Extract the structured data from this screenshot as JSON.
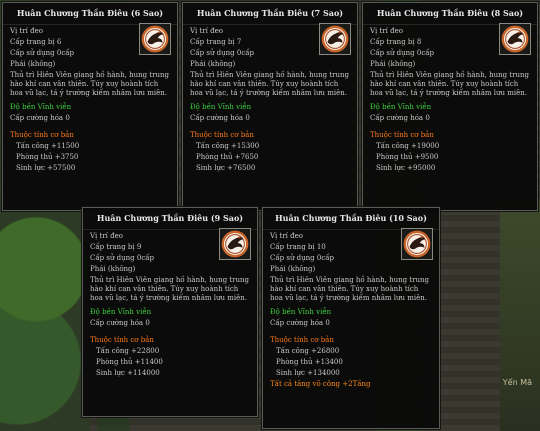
{
  "background": {
    "corner_text": "Yến Mã",
    "corner_text2": ""
  },
  "cards": [
    {
      "title": "Huân Chương Thần Điêu (6 Sao)",
      "position_label": "Vị trí đeo",
      "equip_level": "Cấp trang bị  6",
      "use_level": "Cấp sử dụng   0cấp",
      "faction": "Phái  (không)",
      "description": "Thủ trì Hiên Viên giang hồ hành, hung trung hào khí can vân thiên. Túy xuy hoành tích hoa vũ lạc, tá ý trường kiếm nhâm lưu miên.",
      "durability": "Độ bền   Vĩnh viễn",
      "enhance": "Cấp cường hóa   0",
      "base_header": "Thuộc tính cơ bản",
      "stats": [
        "Tấn công  +11500",
        "Phòng thủ  +3750",
        "Sinh lực  +57500"
      ],
      "bonus": ""
    },
    {
      "title": "Huân Chương Thần Điêu (7 Sao)",
      "position_label": "Vị trí đeo",
      "equip_level": "Cấp trang bị   7",
      "use_level": "Cấp sử dụng   0cấp",
      "faction": "Phái  (không)",
      "description": "Thủ trì Hiên Viên giang hồ hành, hung trung hào khí can vân thiên. Túy xuy hoành tích hoa vũ lạc, tá ý trường kiếm nhâm lưu miên.",
      "durability": "Độ bền   Vĩnh viễn",
      "enhance": "Cấp cường hóa   0",
      "base_header": "Thuộc tính cơ bản",
      "stats": [
        "Tấn công  +15300",
        "Phòng thủ  +7650",
        "Sinh lực  +76500"
      ],
      "bonus": ""
    },
    {
      "title": "Huân Chương Thần Điêu (8 Sao)",
      "position_label": "Vị trí đeo",
      "equip_level": "Cấp trang bị   8",
      "use_level": "Cấp sử dụng   0cấp",
      "faction": "Phái  (không)",
      "description": "Thủ trì Hiên Viên giang hồ hành, hung trung hào khí can vân thiên. Túy xuy hoành tích hoa vũ lạc, tá ý trường kiếm nhâm lưu miên.",
      "durability": "Độ bền   Vĩnh viễn",
      "enhance": "Cấp cường hóa   0",
      "base_header": "Thuộc tính cơ bản",
      "stats": [
        "Tấn công  +19000",
        "Phòng thủ  +9500",
        "Sinh lực  +95000"
      ],
      "bonus": ""
    },
    {
      "title": "Huân Chương Thần Điêu (9 Sao)",
      "position_label": "Vị trí đeo",
      "equip_level": "Cấp trang bị   9",
      "use_level": "Cấp sử dụng   0cấp",
      "faction": "Phái  (không)",
      "description": "Thủ trì Hiên Viên giang hồ hành, hung trung hào khí can vân thiên. Túy xuy hoành tích hoa vũ lạc, tá ý trường kiếm nhâm lưu miên.",
      "durability": "Độ bền   Vĩnh viễn",
      "enhance": "Cấp cường hóa   0",
      "base_header": "Thuộc tính cơ bản",
      "stats": [
        "Tấn công  +22800",
        "Phòng thủ  +11400",
        "Sinh lực  +114000"
      ],
      "bonus": ""
    },
    {
      "title": "Huân Chương Thần Điêu (10 Sao)",
      "position_label": "Vị trí đeo",
      "equip_level": "Cấp trang bị   10",
      "use_level": "Cấp sử dụng   0cấp",
      "faction": "Phái  (không)",
      "description": "Thủ trì Hiên Viên giang hồ hành, hung trung hào khí can vân thiên. Túy xuy hoành tích hoa vũ lạc, tá ý trường kiếm nhâm lưu miên.",
      "durability": "Độ bền   Vĩnh viễn",
      "enhance": "Cấp cường hóa   0",
      "base_header": "Thuộc tính cơ bản",
      "stats": [
        "Tấn công  +26800",
        "Phòng thủ  +13400",
        "Sinh lực  +134000"
      ],
      "bonus": "Tất cả tăng võ công +2Tầng"
    }
  ],
  "icon": "eagle-medal-icon",
  "colors": {
    "title": "#e8e8e8",
    "durability": "#3ed13e",
    "section_header": "#ff7a1c",
    "text": "#c9c9c9"
  }
}
